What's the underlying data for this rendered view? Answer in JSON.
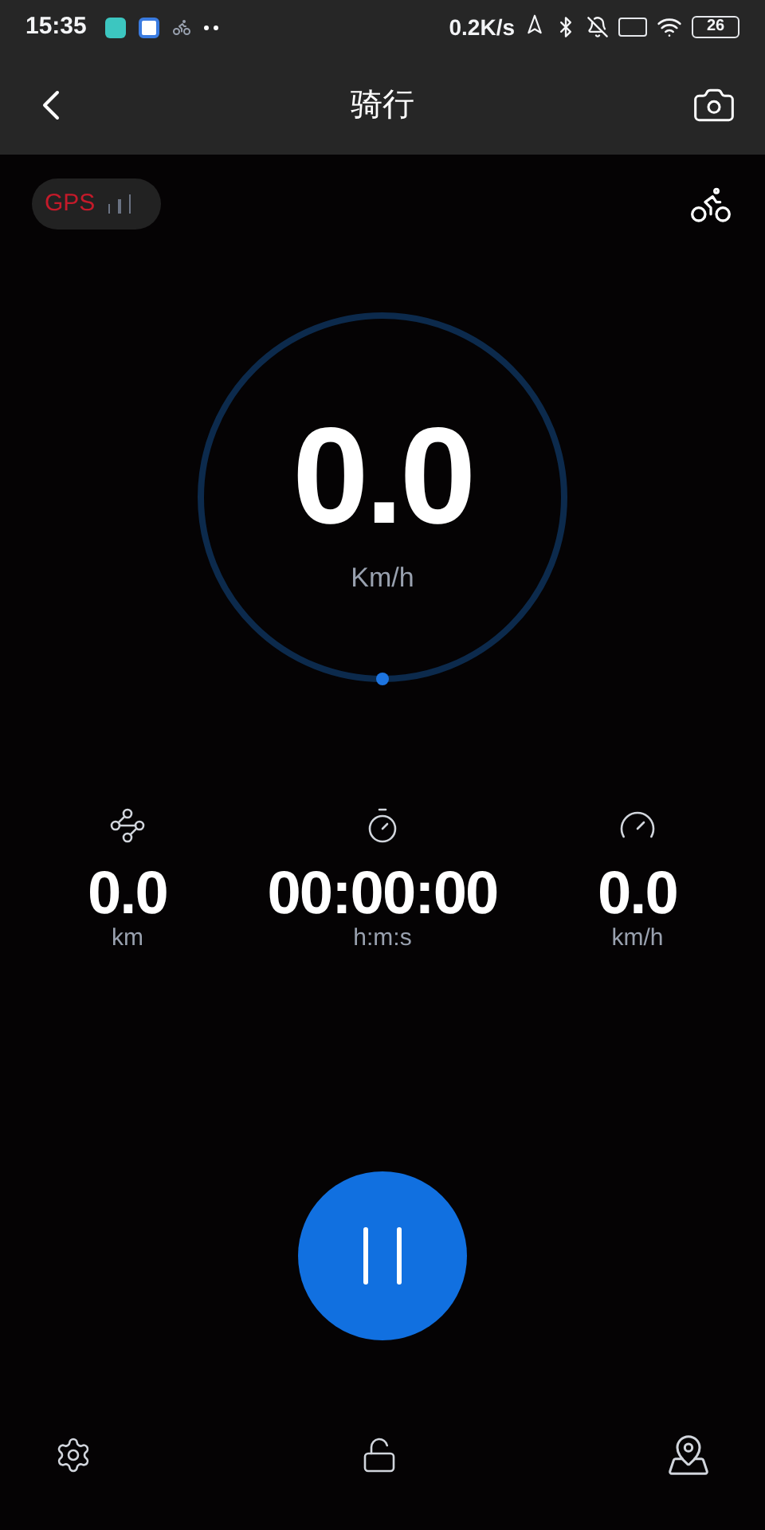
{
  "status_bar": {
    "time": "15:35",
    "network_speed": "0.2K/s",
    "battery": "26"
  },
  "header": {
    "title": "骑行"
  },
  "gps": {
    "label": "GPS"
  },
  "speed": {
    "value": "0.0",
    "unit": "Km/h"
  },
  "stats": [
    {
      "kind": "distance",
      "value": "0.0",
      "unit": "km"
    },
    {
      "kind": "duration",
      "value": "00:00:00",
      "unit": "h:m:s"
    },
    {
      "kind": "pace",
      "value": "0.0",
      "unit": "km/h"
    }
  ]
}
